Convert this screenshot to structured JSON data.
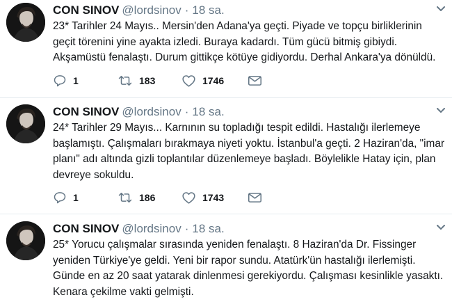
{
  "colors": {
    "text": "#14171a",
    "muted": "#657786",
    "icon": "#657786",
    "divider": "#e6ecf0"
  },
  "tweets": [
    {
      "display_name": "CON SINOV",
      "handle": "@lordsinov",
      "separator": "·",
      "time": "18 sa.",
      "text": "23* Tarihler 24 Mayıs.. Mersin'den Adana'ya geçti. Piyade ve topçu birliklerinin\ngeçit törenini yine ayakta izledi. Buraya kadardı. Tüm gücü bitmiş gibiydi.\nAkşamüstü fenalaştı. Durum gittikçe kötüye gidiyordu. Derhal Ankara'ya dönüldü.",
      "replies": "1",
      "retweets": "183",
      "likes": "1746",
      "icons": [
        "reply-icon",
        "retweet-icon",
        "like-icon",
        "message-icon",
        "caret-down-icon"
      ]
    },
    {
      "display_name": "CON SINOV",
      "handle": "@lordsinov",
      "separator": "·",
      "time": "18 sa.",
      "text": "24* Tarihler 29 Mayıs... Karnının su topladığı tespit edildi. Hastalığı ilerlemeye\nbaşlamıştı. Çalışmaları bırakmaya niyeti yoktu. İstanbul'a geçti. 2 Haziran'da, \"imar\nplanı\" adı altında gizli toplantılar düzenlemeye başladı. Böylelikle Hatay için, plan\ndevreye sokuldu.",
      "replies": "1",
      "retweets": "186",
      "likes": "1743",
      "icons": [
        "reply-icon",
        "retweet-icon",
        "like-icon",
        "message-icon",
        "caret-down-icon"
      ]
    },
    {
      "display_name": "CON SINOV",
      "handle": "@lordsinov",
      "separator": "·",
      "time": "18 sa.",
      "text": "25* Yorucu çalışmalar sırasında yeniden fenalaştı. 8 Haziran'da Dr. Fissinger\nyeniden Türkiye'ye geldi. Yeni bir rapor sundu. Atatürk'ün hastalığı ilerlemişti.\nGünde en az 20 saat yatarak dinlenmesi gerekiyordu. Çalışması kesinlikle yasaktı.\nKenara çekilme vakti gelmişti.",
      "icons": [
        "caret-down-icon"
      ]
    }
  ]
}
